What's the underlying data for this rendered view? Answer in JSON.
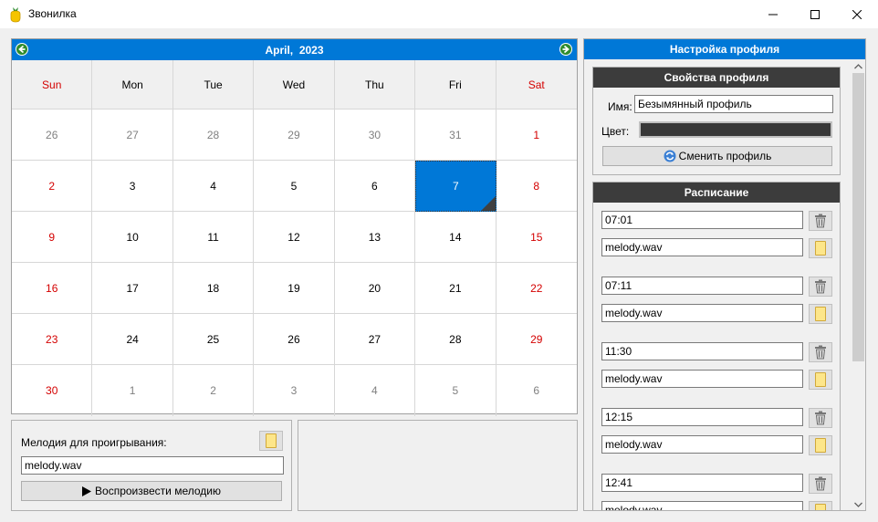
{
  "window": {
    "title": "Звонилка",
    "controls": {
      "minimize": "minimize-icon",
      "maximize": "maximize-icon",
      "close": "close-icon"
    }
  },
  "calendar": {
    "month": "April,",
    "year": "2023",
    "days_of_week": [
      "Sun",
      "Mon",
      "Tue",
      "Wed",
      "Thu",
      "Fri",
      "Sat"
    ],
    "weeks": [
      [
        "26",
        "27",
        "28",
        "29",
        "30",
        "31",
        "1"
      ],
      [
        "2",
        "3",
        "4",
        "5",
        "6",
        "7",
        "8"
      ],
      [
        "9",
        "10",
        "11",
        "12",
        "13",
        "14",
        "15"
      ],
      [
        "16",
        "17",
        "18",
        "19",
        "20",
        "21",
        "22"
      ],
      [
        "23",
        "24",
        "25",
        "26",
        "27",
        "28",
        "29"
      ],
      [
        "30",
        "1",
        "2",
        "3",
        "4",
        "5",
        "6"
      ]
    ],
    "selected_day": "7",
    "colors": {
      "header": "#0078d7",
      "weekend": "#d40000",
      "other_month": "#808080",
      "selected": "#0078d7"
    }
  },
  "melody": {
    "label": "Мелодия для проигрывания:",
    "file_value": "melody.wav",
    "play_label": "Воспроизвести мелодию"
  },
  "profile": {
    "header": "Настройка профиля",
    "properties": {
      "title": "Свойства профиля",
      "name_label": "Имя:",
      "name_value": "Безымянный профиль",
      "color_label": "Цвет:",
      "color_value": "#383838",
      "change_button": "Сменить профиль"
    },
    "schedule": {
      "title": "Расписание",
      "entries": [
        {
          "time": "07:01",
          "melody": "melody.wav"
        },
        {
          "time": "07:11",
          "melody": "melody.wav"
        },
        {
          "time": "11:30",
          "melody": "melody.wav"
        },
        {
          "time": "12:15",
          "melody": "melody.wav"
        },
        {
          "time": "12:41",
          "melody": "melody.wav"
        }
      ]
    }
  }
}
